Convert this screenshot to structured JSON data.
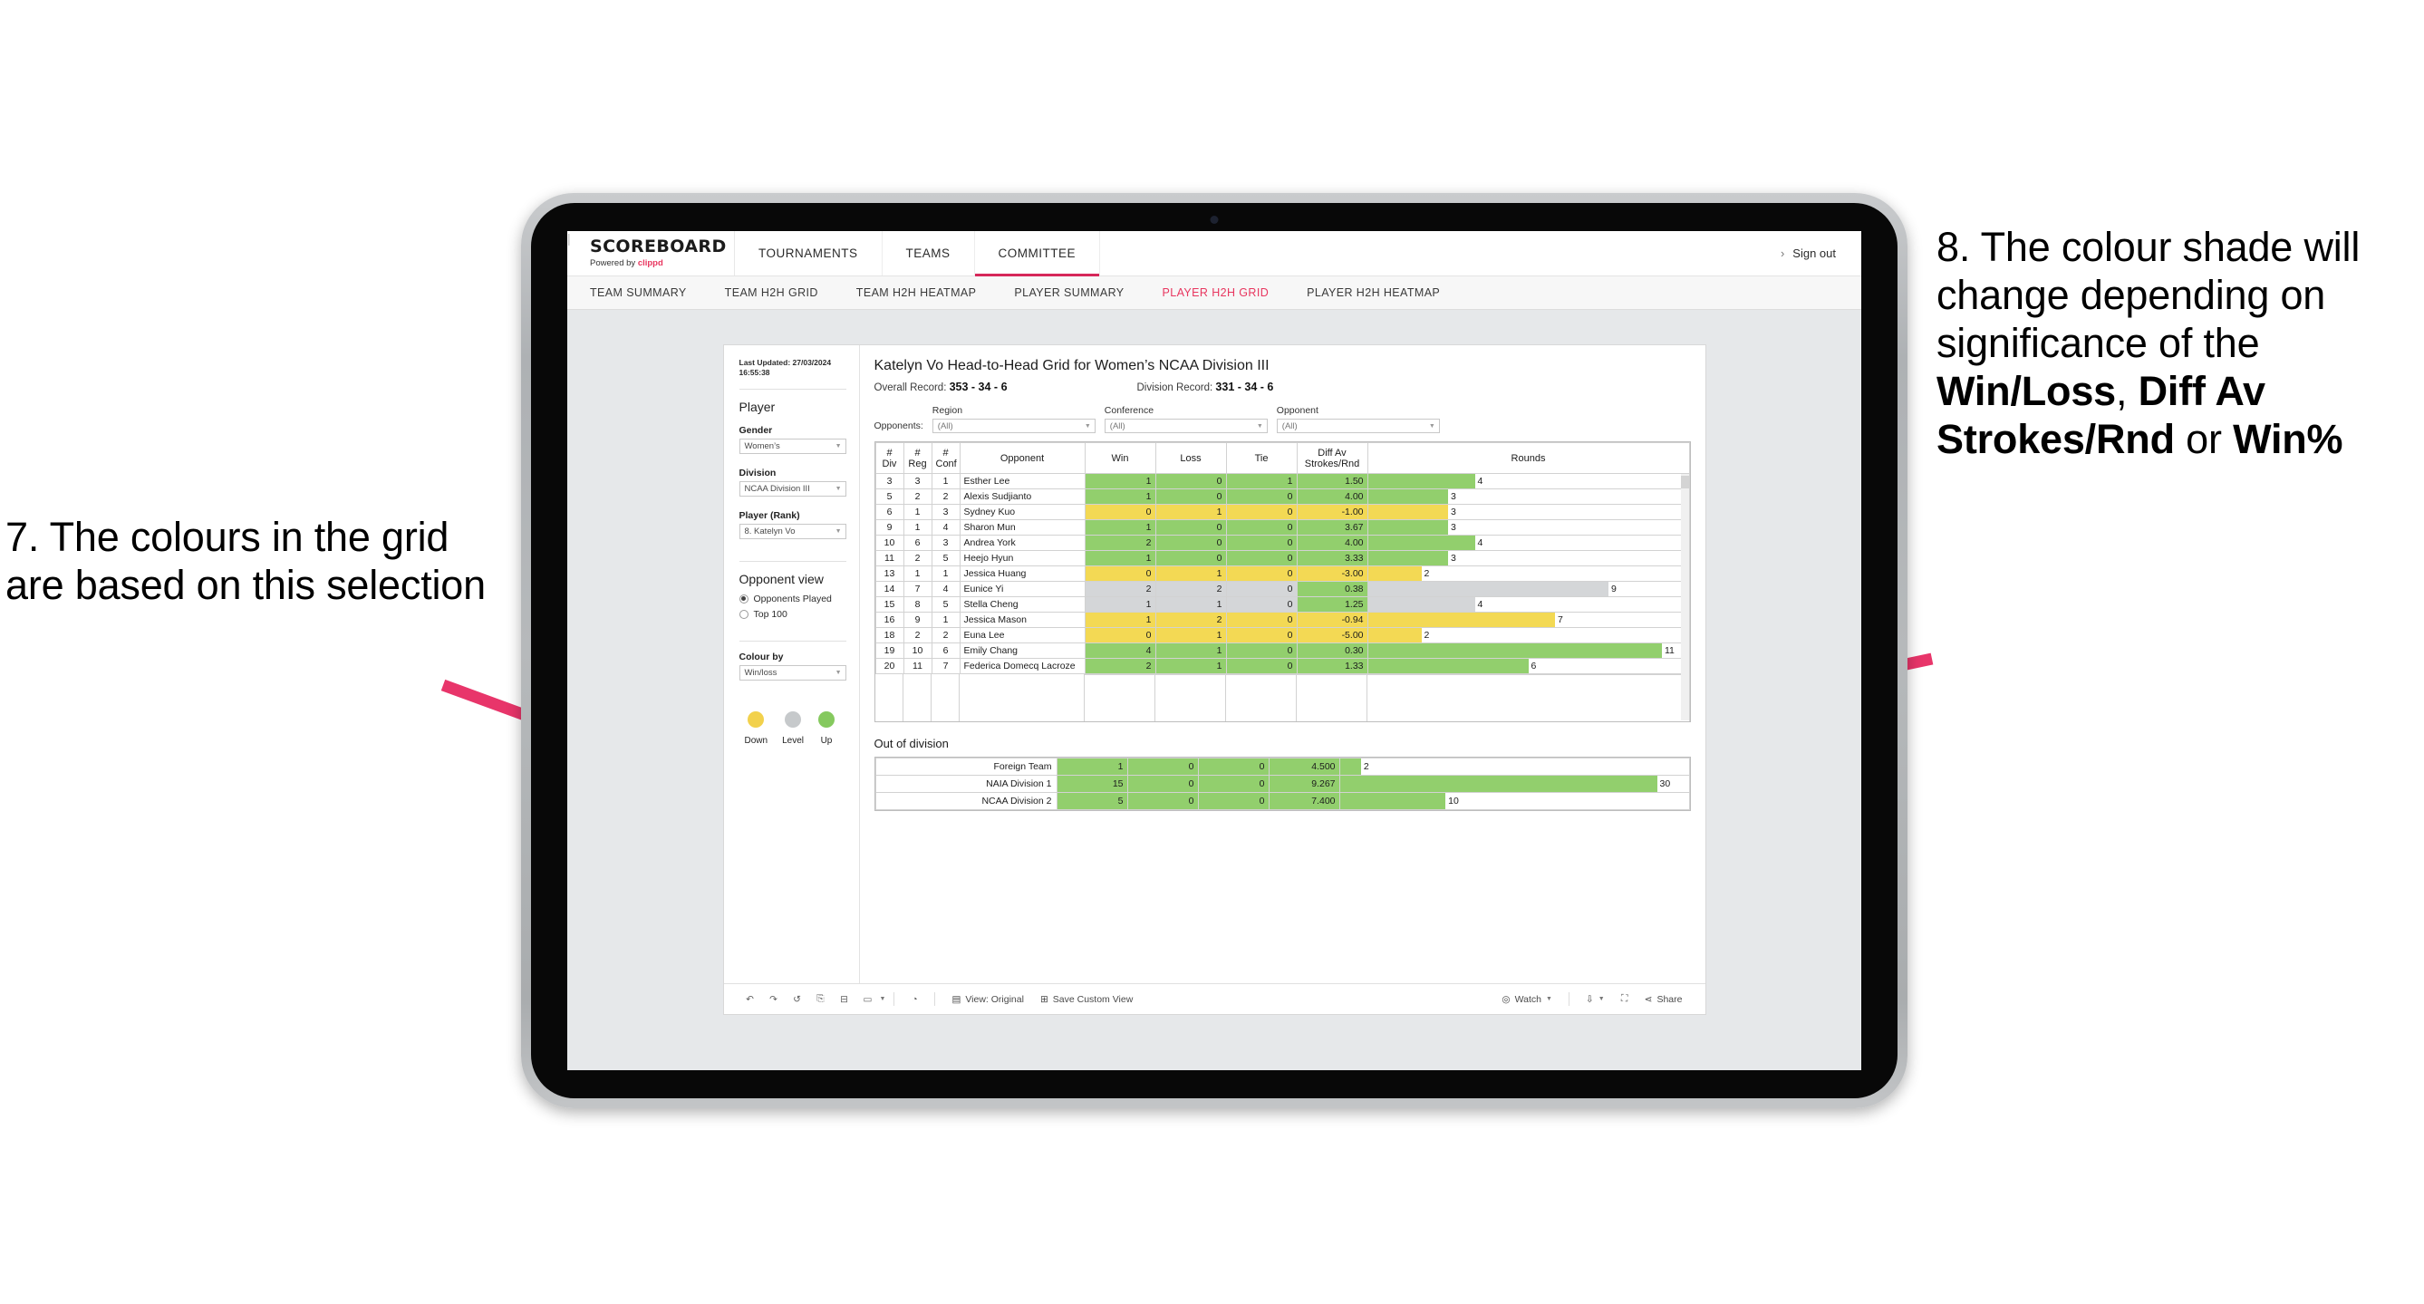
{
  "annotations": {
    "left": "7. The colours in the grid are based on this selection",
    "right_plain_1": "8. The colour shade will change depending on significance of the ",
    "right_bold_1": "Win/Loss",
    "right_plain_2": ", ",
    "right_bold_2": "Diff Av Strokes/Rnd",
    "right_plain_3": " or ",
    "right_bold_3": "Win%",
    "arrow_color": "#e8356a"
  },
  "header": {
    "brand_title": "SCOREBOARD",
    "brand_sub_prefix": "Powered by ",
    "brand_sub_accent": "clippd",
    "tabs": [
      {
        "label": "TOURNAMENTS",
        "active": false
      },
      {
        "label": "TEAMS",
        "active": false
      },
      {
        "label": "COMMITTEE",
        "active": true
      }
    ],
    "chevron": "›",
    "divider": "|",
    "sign_out": "Sign out",
    "accent_color": "#d6275a"
  },
  "sub_nav": {
    "tabs": [
      {
        "label": "TEAM SUMMARY",
        "active": false
      },
      {
        "label": "TEAM H2H GRID",
        "active": false
      },
      {
        "label": "TEAM H2H HEATMAP",
        "active": false
      },
      {
        "label": "PLAYER SUMMARY",
        "active": false
      },
      {
        "label": "PLAYER H2H GRID",
        "active": true
      },
      {
        "label": "PLAYER H2H HEATMAP",
        "active": false
      }
    ]
  },
  "filter_panel": {
    "last_updated": "Last Updated: 27/03/2024 16:55:38",
    "section_player": "Player",
    "gender_label": "Gender",
    "gender_value": "Women’s",
    "division_label": "Division",
    "division_value": "NCAA Division III",
    "player_rank_label": "Player (Rank)",
    "player_rank_value": "8. Katelyn Vo",
    "opponent_view_label": "Opponent view",
    "opponent_view_options": [
      {
        "label": "Opponents Played",
        "selected": true
      },
      {
        "label": "Top 100",
        "selected": false
      }
    ],
    "colour_by_label": "Colour by",
    "colour_by_value": "Win/loss",
    "legend": [
      {
        "label": "Down",
        "color": "#f2d14c"
      },
      {
        "label": "Level",
        "color": "#c6c9cb"
      },
      {
        "label": "Up",
        "color": "#85c95e"
      }
    ]
  },
  "main": {
    "title": "Katelyn Vo Head-to-Head Grid for Women’s NCAA Division III",
    "overall_record_label": "Overall Record: ",
    "overall_record_value": "353 - 34 - 6",
    "division_record_label": "Division Record: ",
    "division_record_value": "331 - 34 - 6",
    "opponents_label": "Opponents:",
    "opponent_filters": [
      {
        "label": "Region",
        "value": "(All)"
      },
      {
        "label": "Conference",
        "value": "(All)"
      },
      {
        "label": "Opponent",
        "value": "(All)"
      }
    ],
    "out_of_division_title": "Out of division"
  },
  "chart_data": {
    "type": "table",
    "title": "Katelyn Vo Head-to-Head Grid for Women’s NCAA Division III",
    "columns": [
      "# Div",
      "# Reg",
      "# Conf",
      "Opponent",
      "Win",
      "Loss",
      "Tie",
      "Diff Av Strokes/Rnd",
      "Rounds"
    ],
    "column_headers_two_line": [
      {
        "l1": "#",
        "l2": "Div"
      },
      {
        "l1": "#",
        "l2": "Reg"
      },
      {
        "l1": "#",
        "l2": "Conf"
      },
      {
        "l1": "Opponent",
        "l2": ""
      },
      {
        "l1": "Win",
        "l2": ""
      },
      {
        "l1": "Loss",
        "l2": ""
      },
      {
        "l1": "Tie",
        "l2": ""
      },
      {
        "l1": "Diff Av",
        "l2": "Strokes/Rnd"
      },
      {
        "l1": "Rounds",
        "l2": ""
      }
    ],
    "colors": {
      "up": "#92cf6d",
      "down": "#f3d954",
      "level": "#d4d6d8",
      "none": "#ffffff"
    },
    "rounds_max": 12,
    "rows": [
      {
        "div": "3",
        "reg": "3",
        "conf": "1",
        "opponent": "Esther Lee",
        "win": "1",
        "loss": "0",
        "tie": "1",
        "diff": "1.50",
        "rounds": 4,
        "shade": "up"
      },
      {
        "div": "5",
        "reg": "2",
        "conf": "2",
        "opponent": "Alexis Sudjianto",
        "win": "1",
        "loss": "0",
        "tie": "0",
        "diff": "4.00",
        "rounds": 3,
        "shade": "up"
      },
      {
        "div": "6",
        "reg": "1",
        "conf": "3",
        "opponent": "Sydney Kuo",
        "win": "0",
        "loss": "1",
        "tie": "0",
        "diff": "-1.00",
        "rounds": 3,
        "shade": "down"
      },
      {
        "div": "9",
        "reg": "1",
        "conf": "4",
        "opponent": "Sharon Mun",
        "win": "1",
        "loss": "0",
        "tie": "0",
        "diff": "3.67",
        "rounds": 3,
        "shade": "up"
      },
      {
        "div": "10",
        "reg": "6",
        "conf": "3",
        "opponent": "Andrea York",
        "win": "2",
        "loss": "0",
        "tie": "0",
        "diff": "4.00",
        "rounds": 4,
        "shade": "up"
      },
      {
        "div": "11",
        "reg": "2",
        "conf": "5",
        "opponent": "Heejo Hyun",
        "win": "1",
        "loss": "0",
        "tie": "0",
        "diff": "3.33",
        "rounds": 3,
        "shade": "up"
      },
      {
        "div": "13",
        "reg": "1",
        "conf": "1",
        "opponent": "Jessica Huang",
        "win": "0",
        "loss": "1",
        "tie": "0",
        "diff": "-3.00",
        "rounds": 2,
        "shade": "down"
      },
      {
        "div": "14",
        "reg": "7",
        "conf": "4",
        "opponent": "Eunice Yi",
        "win": "2",
        "loss": "2",
        "tie": "0",
        "diff": "0.38",
        "rounds": 9,
        "shade": "level",
        "diff_shade": "up"
      },
      {
        "div": "15",
        "reg": "8",
        "conf": "5",
        "opponent": "Stella Cheng",
        "win": "1",
        "loss": "1",
        "tie": "0",
        "diff": "1.25",
        "rounds": 4,
        "shade": "level",
        "diff_shade": "up"
      },
      {
        "div": "16",
        "reg": "9",
        "conf": "1",
        "opponent": "Jessica Mason",
        "win": "1",
        "loss": "2",
        "tie": "0",
        "diff": "-0.94",
        "rounds": 7,
        "shade": "down"
      },
      {
        "div": "18",
        "reg": "2",
        "conf": "2",
        "opponent": "Euna Lee",
        "win": "0",
        "loss": "1",
        "tie": "0",
        "diff": "-5.00",
        "rounds": 2,
        "shade": "down"
      },
      {
        "div": "19",
        "reg": "10",
        "conf": "6",
        "opponent": "Emily Chang",
        "win": "4",
        "loss": "1",
        "tie": "0",
        "diff": "0.30",
        "rounds": 11,
        "shade": "up"
      },
      {
        "div": "20",
        "reg": "11",
        "conf": "7",
        "opponent": "Federica Domecq Lacroze",
        "win": "2",
        "loss": "1",
        "tie": "0",
        "diff": "1.33",
        "rounds": 6,
        "shade": "up"
      }
    ],
    "out_of_division_rows": [
      {
        "name": "Foreign Team",
        "win": "1",
        "loss": "0",
        "tie": "0",
        "diff": "4.500",
        "rounds": 2,
        "shade": "up"
      },
      {
        "name": "NAIA Division 1",
        "win": "15",
        "loss": "0",
        "tie": "0",
        "diff": "9.267",
        "rounds": 30,
        "shade": "up"
      },
      {
        "name": "NCAA Division 2",
        "win": "5",
        "loss": "0",
        "tie": "0",
        "diff": "7.400",
        "rounds": 10,
        "shade": "up"
      }
    ],
    "out_of_division_rounds_max": 33
  },
  "toolbar": {
    "view_label": "View: Original",
    "save_label": "Save Custom View",
    "watch_label": "Watch",
    "share_label": "Share"
  }
}
